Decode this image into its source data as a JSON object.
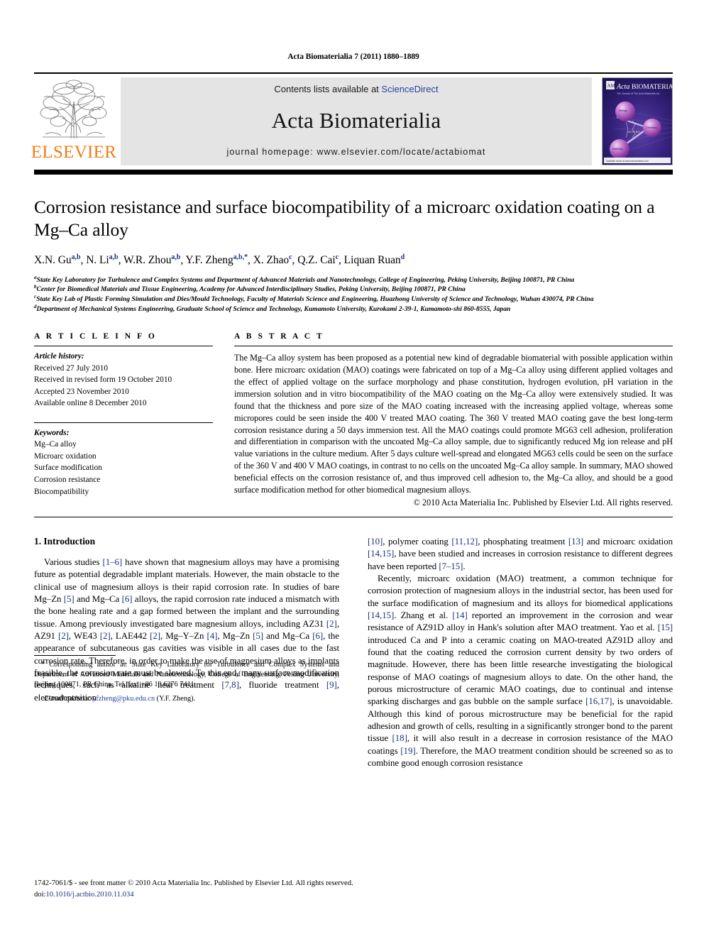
{
  "running_head": "Acta Biomaterialia 7 (2011) 1880–1889",
  "masthead": {
    "publisher_name": "ELSEVIER",
    "contents_prefix": "Contents lists available at ",
    "sciencedirect": "ScienceDirect",
    "journal_title": "Acta Biomaterialia",
    "homepage": "journal homepage: www.elsevier.com/locate/actabiomat",
    "cover_title_italic": "Acta",
    "cover_title_rest": "BIOMATERIALIA",
    "cover_subtitle": "The Journal of The Acta Materialia Inc.",
    "cover_sphere_labels": [
      "Biology",
      "Chemistry",
      "Materials"
    ],
    "cover_center_label": "ACTA BIO"
  },
  "article": {
    "title": "Corrosion resistance and surface biocompatibility of a microarc oxidation coating on a Mg–Ca alloy",
    "authors": [
      {
        "name": "X.N. Gu",
        "sup": "a,b",
        "sep": ", "
      },
      {
        "name": "N. Li",
        "sup": "a,b",
        "sep": ", "
      },
      {
        "name": "W.R. Zhou",
        "sup": "a,b",
        "sep": ", "
      },
      {
        "name": "Y.F. Zheng",
        "sup": "a,b,*",
        "sep": ", "
      },
      {
        "name": "X. Zhao",
        "sup": "c",
        "sep": ", "
      },
      {
        "name": "Q.Z. Cai",
        "sup": "c",
        "sep": ", "
      },
      {
        "name": "Liquan Ruan",
        "sup": "d",
        "sep": ""
      }
    ],
    "affiliations": [
      {
        "label": "a",
        "text": "State Key Laboratory for Turbulence and Complex Systems and Department of Advanced Materials and Nanotechnology, College of Engineering, Peking University, Beijing 100871, PR China"
      },
      {
        "label": "b",
        "text": "Center for Biomedical Materials and Tissue Engineering, Academy for Advanced Interdisciplinary Studies, Peking University, Beijing 100871, PR China"
      },
      {
        "label": "c",
        "text": "State Key Lab of Plastic Forming Simulation and Dies/Mould Technology, Faculty of Materials Science and Engineering, Huazhong University of Science and Technology, Wuhan 430074, PR China"
      },
      {
        "label": "d",
        "text": "Department of Mechanical Systems Engineering, Graduate School of Science and Technology, Kumamoto University, Kurokami 2-39-1, Kumamoto-shi 860-8555, Japan"
      }
    ]
  },
  "article_info": {
    "heading": "A R T I C L E   I N F O",
    "history_label": "Article history:",
    "history": [
      "Received 27 July 2010",
      "Received in revised form 19 October 2010",
      "Accepted 23 November 2010",
      "Available online 8 December 2010"
    ],
    "keywords_label": "Keywords:",
    "keywords": [
      "Mg–Ca alloy",
      "Microarc oxidation",
      "Surface modification",
      "Corrosion resistance",
      "Biocompatibility"
    ]
  },
  "abstract": {
    "heading": "A B S T R A C T",
    "text": "The Mg–Ca alloy system has been proposed as a potential new kind of degradable biomaterial with possible application within bone. Here microarc oxidation (MAO) coatings were fabricated on top of a Mg–Ca alloy using different applied voltages and the effect of applied voltage on the surface morphology and phase constitution, hydrogen evolution, pH variation in the immersion solution and in vitro biocompatibility of the MAO coating on the Mg–Ca alloy were extensively studied. It was found that the thickness and pore size of the MAO coating increased with the increasing applied voltage, whereas some micropores could be seen inside the 400 V treated MAO coating. The 360 V treated MAO coating gave the best long-term corrosion resistance during a 50 days immersion test. All the MAO coatings could promote MG63 cell adhesion, proliferation and differentiation in comparison with the uncoated Mg–Ca alloy sample, due to significantly reduced Mg ion release and pH value variations in the culture medium. After 5 days culture well-spread and elongated MG63 cells could be seen on the surface of the 360 V and 400 V MAO coatings, in contrast to no cells on the uncoated Mg–Ca alloy sample. In summary, MAO showed beneficial effects on the corrosion resistance of, and thus improved cell adhesion to, the Mg–Ca alloy, and should be a good surface modification method for other biomedical magnesium alloys.",
    "rights": "© 2010 Acta Materialia Inc. Published by Elsevier Ltd. All rights reserved."
  },
  "introduction": {
    "heading": "1. Introduction",
    "left_paragraphs": [
      "Various studies [1–6] have shown that magnesium alloys may have a promising future as potential degradable implant materials. However, the main obstacle to the clinical use of magnesium alloys is their rapid corrosion rate. In studies of bare Mg–Zn [5] and Mg–Ca [6] alloys, the rapid corrosion rate induced a mismatch with the bone healing rate and a gap formed between the implant and the surrounding tissue. Among previously investigated bare magnesium alloys, including AZ31 [2], AZ91 [2], WE43 [2], LAE442 [2], Mg–Y–Zn [4], Mg–Zn [5] and Mg–Ca [6], the appearance of subcutaneous gas cavities was visible in all cases due to the fast corrosion rate. Therefore, in order to make the use of magnesium alloys as implants feasible, the corrosion rate must be slowed. To this end, many surface modification techniques, such as alkaline heat treatment [7,8], fluoride treatment [9], electrodeposition"
    ],
    "right_paragraphs": [
      "[10], polymer coating [11,12], phosphating treatment [13] and microarc oxidation [14,15], have been studied and increases in corrosion resistance to different degrees have been reported [7–15].",
      "Recently, microarc oxidation (MAO) treatment, a common technique for corrosion protection of magnesium alloys in the industrial sector, has been used for the surface modification of magnesium and its alloys for biomedical applications [14,15]. Zhang et al. [14] reported an improvement in the corrosion and wear resistance of AZ91D alloy in Hank's solution after MAO treatment. Yao et al. [15] introduced Ca and P into a ceramic coating on MAO-treated AZ91D alloy and found that the coating reduced the corrosion current density by two orders of magnitude. However, there has been little researche investigating the biological response of MAO coatings of magnesium alloys to date. On the other hand, the porous microstructure of ceramic MAO coatings, due to continual and intense sparking discharges and gas bubble on the sample surface [16,17], is unavoidable. Although this kind of porous microstructure may be beneficial for the rapid adhesion and growth of cells, resulting in a significantly stronger bond to the parent tissue [18], it will also result in a decrease in corrosion resistance of the MAO coatings [19]. Therefore, the MAO treatment condition should be screened so as to combine good enough corrosion resistance"
    ]
  },
  "footnote": {
    "corresponding": "* Corresponding author at: State Key Laboratory for Turbulence and Complex Systems and Department of Advanced Materials and Nanotechnology, College of Engineering, Peking University, Beijing 100871, PR China. Tel./fax: +86 10 6276 7411.",
    "email_label": "E-mail address:",
    "email": "yfzheng@pku.edu.cn",
    "email_owner": "(Y.F. Zheng)."
  },
  "page_footer": {
    "issn_line": "1742-7061/$ - see front matter © 2010 Acta Materialia Inc. Published by Elsevier Ltd. All rights reserved.",
    "doi_label": "doi:",
    "doi": "10.1016/j.actbio.2010.11.034"
  },
  "colors": {
    "link_blue": "#2b3f9e",
    "ref_blue": "#1d2f7a",
    "elsevier_orange": "#f07d16",
    "banner_gray": "#e4e4e4"
  }
}
